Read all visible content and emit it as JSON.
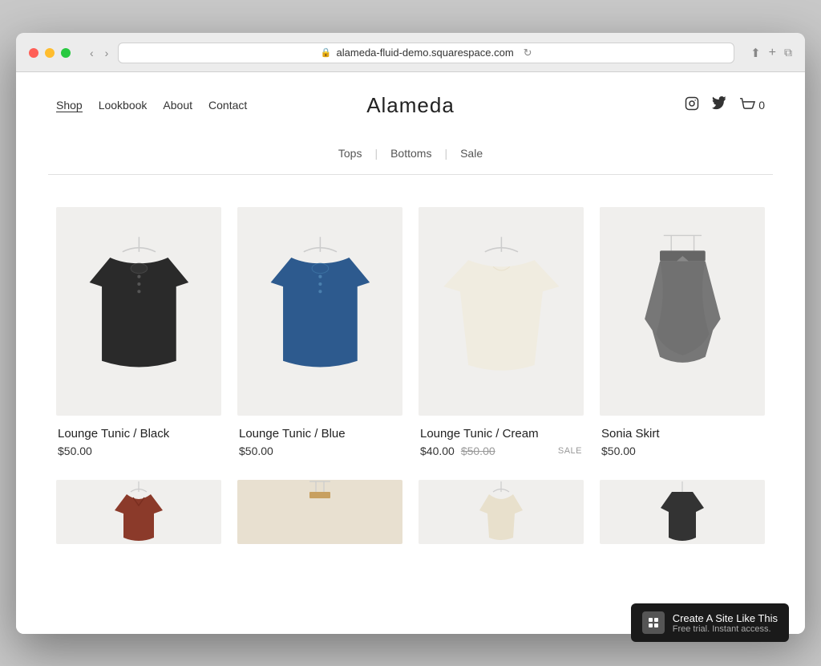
{
  "browser": {
    "url": "alameda-fluid-demo.squarespace.com",
    "back_label": "‹",
    "forward_label": "›"
  },
  "site": {
    "title": "Alameda",
    "nav": [
      {
        "label": "Shop",
        "active": true
      },
      {
        "label": "Lookbook",
        "active": false
      },
      {
        "label": "About",
        "active": false
      },
      {
        "label": "Contact",
        "active": false
      }
    ],
    "cart_count": "0"
  },
  "filters": {
    "items": [
      "Tops",
      "Bottoms",
      "Sale"
    ]
  },
  "products": [
    {
      "name": "Lounge Tunic / Black",
      "price": "$50.00",
      "orig_price": null,
      "sale": false,
      "color": "black"
    },
    {
      "name": "Lounge Tunic / Blue",
      "price": "$50.00",
      "orig_price": null,
      "sale": false,
      "color": "blue"
    },
    {
      "name": "Lounge Tunic / Cream",
      "price": "$40.00",
      "orig_price": "$50.00",
      "sale": true,
      "color": "cream"
    },
    {
      "name": "Sonia Skirt",
      "price": "$50.00",
      "orig_price": null,
      "sale": false,
      "color": "gray"
    }
  ],
  "bottom_products": [
    {
      "color": "rust",
      "partial": true
    },
    {
      "color": "tan",
      "partial": true
    },
    {
      "color": "cream",
      "partial": true
    },
    {
      "color": "darkgray",
      "partial": true
    }
  ],
  "squarespace_badge": {
    "main": "Create A Site Like This",
    "sub": "Free trial. Instant access."
  }
}
